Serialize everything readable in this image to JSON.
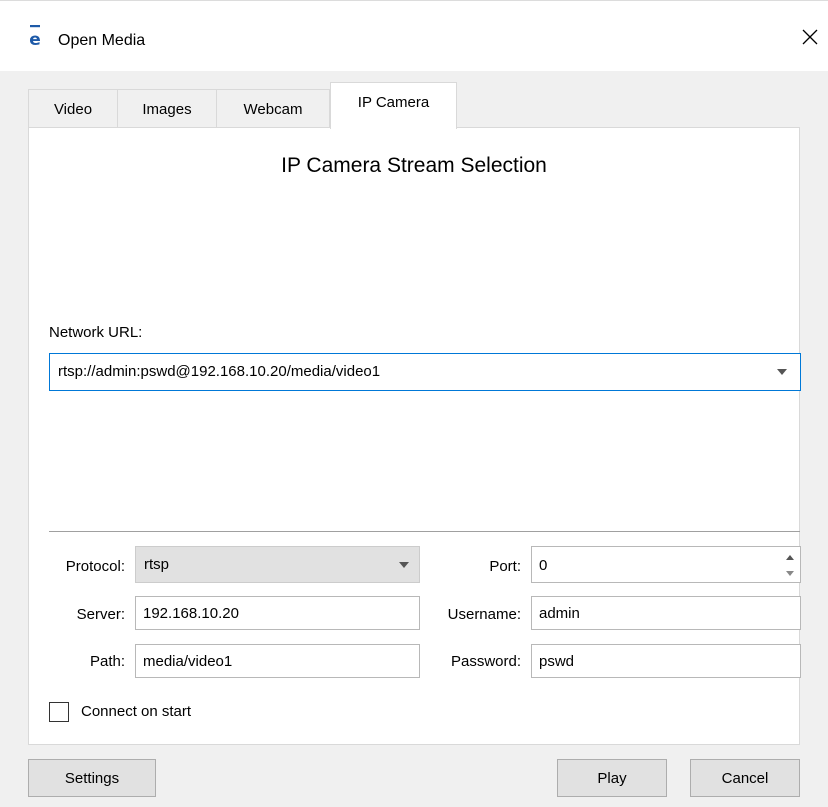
{
  "window": {
    "title": "Open Media",
    "app_icon_glyph": "e"
  },
  "tabs": [
    {
      "label": "Video",
      "active": false
    },
    {
      "label": "Images",
      "active": false
    },
    {
      "label": "Webcam",
      "active": false
    },
    {
      "label": "IP Camera",
      "active": true
    }
  ],
  "panel": {
    "heading": "IP Camera Stream Selection",
    "network_url": {
      "label": "Network URL:",
      "value": "rtsp://admin:pswd@192.168.10.20/media/video1"
    },
    "protocol": {
      "label": "Protocol:",
      "value": "rtsp"
    },
    "port": {
      "label": "Port:",
      "value": "0"
    },
    "server": {
      "label": "Server:",
      "value": "192.168.10.20"
    },
    "username": {
      "label": "Username:",
      "value": "admin"
    },
    "path": {
      "label": "Path:",
      "value": "media/video1"
    },
    "password": {
      "label": "Password:",
      "value": "pswd"
    },
    "connect_on_start": {
      "label": "Connect on start",
      "checked": false
    }
  },
  "buttons": {
    "settings": "Settings",
    "play": "Play",
    "cancel": "Cancel"
  },
  "colors": {
    "focus_border": "#0078d7",
    "app_icon": "#1e5aa8"
  }
}
